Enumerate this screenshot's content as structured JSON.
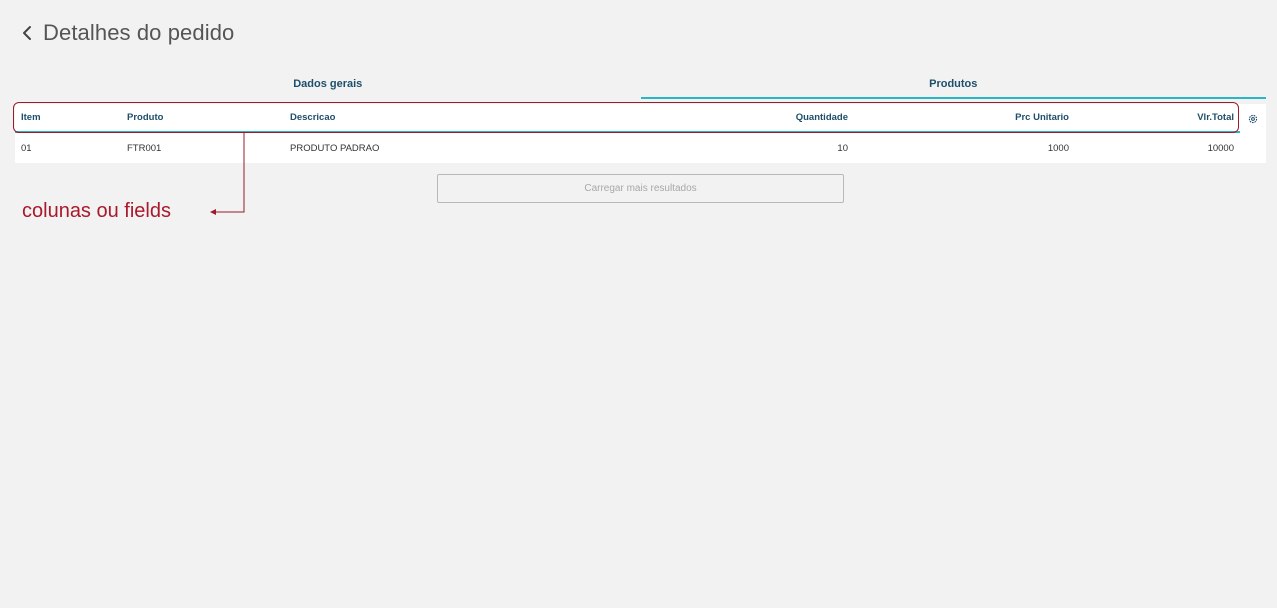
{
  "page": {
    "title": "Detalhes do pedido"
  },
  "tabs": [
    {
      "label": "Dados gerais",
      "active": false
    },
    {
      "label": "Produtos",
      "active": true
    }
  ],
  "table": {
    "columns": [
      "Item",
      "Produto",
      "Descricao",
      "Quantidade",
      "Prc Unitario",
      "Vlr.Total"
    ],
    "rows": [
      [
        "01",
        "FTR001",
        "PRODUTO PADRAO",
        "10",
        "1000",
        "10000"
      ]
    ]
  },
  "load_more": {
    "label": "Carregar mais resultados"
  },
  "annotation": {
    "label": "colunas ou fields",
    "color": "#a8192b"
  },
  "colors": {
    "accent": "#29b6c6",
    "header_text": "#1d4e6b",
    "background": "#f2f2f2"
  }
}
